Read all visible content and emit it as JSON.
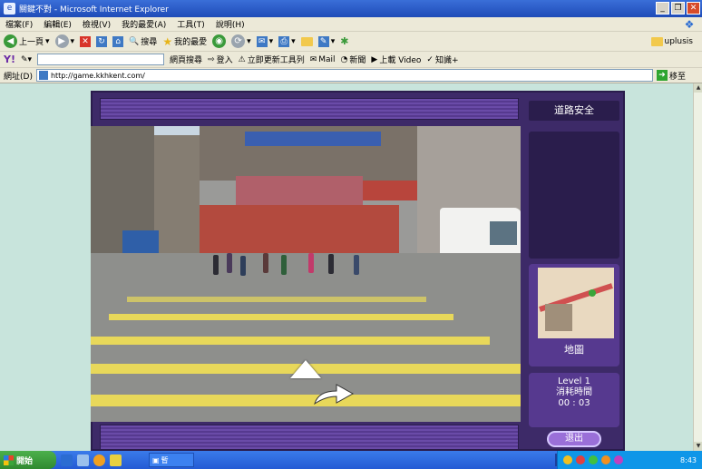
{
  "window": {
    "title": "關鍵不對 - Microsoft Internet Explorer",
    "buttons": {
      "minimize": "_",
      "maximize": "❐",
      "close": "✕"
    }
  },
  "menu": [
    "檔案(F)",
    "編輯(E)",
    "檢視(V)",
    "我的最愛(A)",
    "工具(T)",
    "說明(H)"
  ],
  "toolbar": {
    "back": "上一頁",
    "search": "搜尋",
    "favorites": "我的最愛",
    "links": "uplusis"
  },
  "toolbar2": {
    "search_web": "網頁搜尋",
    "signin": "登入",
    "toolbar_btn": "立即更新工具列",
    "mail": "Mail",
    "news": "新聞",
    "video": "上載 Video",
    "answers": "知識+"
  },
  "address": {
    "label": "網址(D)",
    "url": "http://game.kkhkent.com/",
    "go": "移至"
  },
  "game": {
    "panel_title": "道路安全",
    "map_label": "地圖",
    "level": "Level 1",
    "time_label": "消耗時間",
    "time_value": "00 : 03",
    "exit": "退出"
  },
  "taskbar": {
    "start": "開始",
    "task": "暫",
    "time": "8:43"
  },
  "colors": {
    "frame": "#3d2a68",
    "panel": "#56398f",
    "page_bg": "#c8e4dc",
    "crosswalk": "#e8d85a"
  }
}
